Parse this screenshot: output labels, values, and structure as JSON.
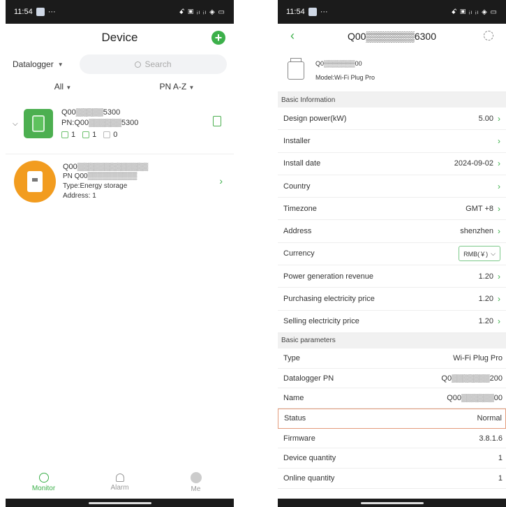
{
  "status_bar": {
    "time": "11:54",
    "dots": "···",
    "right": "ꗃ ▣ ᵢₗ ᵢₗ ◈ ▭"
  },
  "left": {
    "title": "Device",
    "add_icon": "+",
    "datalogger_label": "Datalogger",
    "search_placeholder": "Search",
    "sort_all": "All",
    "sort_pn": "PN A-Z",
    "device1": {
      "name": "Q00▒▒▒▒▒5300",
      "pn": "PN:Q00▒▒▒▒▒▒5300",
      "count_a": "1",
      "count_b": "1",
      "count_c": "0"
    },
    "device2": {
      "pn_top": "Q00▒▒▒▒▒▒▒▒▒▒▒▒▒",
      "pn": "PN Q00▒▒▒▒▒▒▒▒▒▒",
      "type": "Type:Energy storage",
      "address": "Address: 1"
    },
    "tabs": {
      "monitor": "Monitor",
      "alarm": "Alarm",
      "me": "Me"
    }
  },
  "right": {
    "title": "Q00▒▒▒▒▒▒▒6300",
    "device_pn": "Q0▒▒▒▒▒▒▒00",
    "model": "Model:Wi-Fi Plug Pro",
    "section_basic_info": "Basic Information",
    "info_rows": [
      {
        "label": "Design power(kW)",
        "value": "5.00"
      },
      {
        "label": "Installer",
        "value": ""
      },
      {
        "label": "Install date",
        "value": "2024-09-02"
      },
      {
        "label": "Country",
        "value": ""
      },
      {
        "label": "Timezone",
        "value": "GMT +8"
      },
      {
        "label": "Address",
        "value": "shenzhen"
      },
      {
        "label": "Currency",
        "value": "RMB(￥)"
      },
      {
        "label": "Power generation revenue",
        "value": "1.20"
      },
      {
        "label": "Purchasing electricity price",
        "value": "1.20"
      },
      {
        "label": "Selling electricity price",
        "value": "1.20"
      }
    ],
    "section_basic_params": "Basic parameters",
    "param_rows": [
      {
        "label": "Type",
        "value": "Wi-Fi Plug Pro"
      },
      {
        "label": "Datalogger PN",
        "value": "Q0▒▒▒▒▒▒▒200"
      },
      {
        "label": "Name",
        "value": "Q00▒▒▒▒▒▒00"
      },
      {
        "label": "Status",
        "value": "Normal"
      },
      {
        "label": "Firmware",
        "value": "3.8.1.6"
      },
      {
        "label": "Device quantity",
        "value": "1"
      },
      {
        "label": "Online quantity",
        "value": "1"
      }
    ]
  }
}
